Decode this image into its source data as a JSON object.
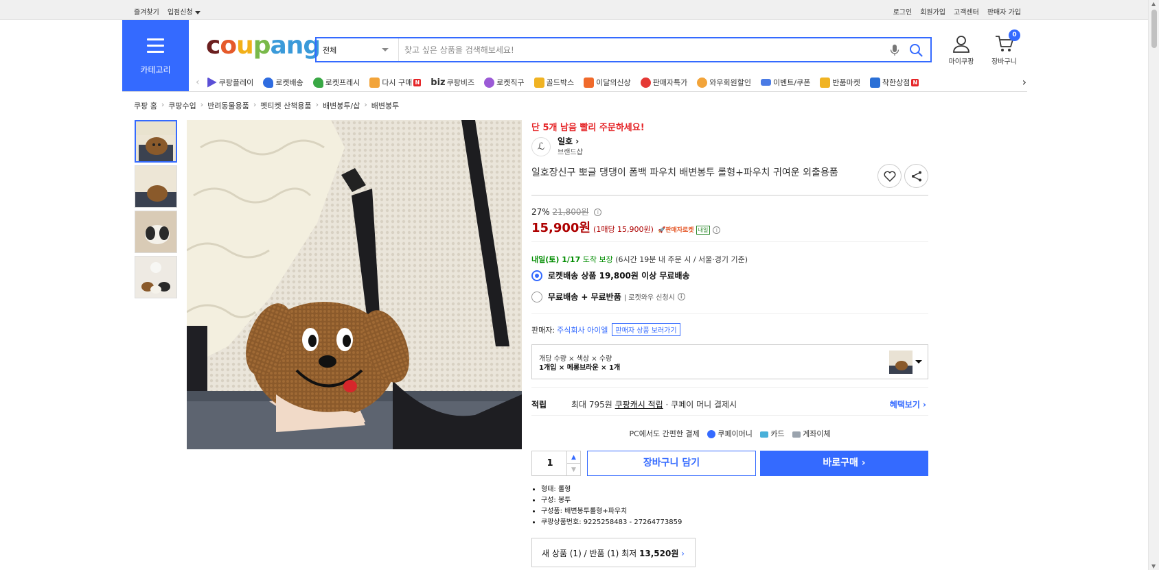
{
  "topbar": {
    "left": [
      "즐겨찾기",
      "입점신청"
    ],
    "right": [
      "로그인",
      "회원가입",
      "고객센터",
      "판매자 가입"
    ]
  },
  "category_button": {
    "label": "카테고리"
  },
  "logo": {
    "text_parts": [
      "c",
      "o",
      "u",
      "p",
      "ang"
    ]
  },
  "search": {
    "scope": "전체",
    "placeholder": "찾고 싶은 상품을 검색해보세요!"
  },
  "header_icons": {
    "mycoupang": "마이쿠팡",
    "cart": "장바구니",
    "cart_count": "0"
  },
  "nav": {
    "items": [
      {
        "label": "쿠팡플레이",
        "icon": "play-icon",
        "color": "#5a4fd6"
      },
      {
        "label": "로켓배송",
        "icon": "rocket-icon",
        "color": "#2f6ce0"
      },
      {
        "label": "로켓프레시",
        "icon": "rocket-fresh-icon",
        "color": "#39a845"
      },
      {
        "label": "다시 구매",
        "icon": "bag-icon",
        "color": "#f2a43a"
      },
      {
        "label": "쿠팡비즈",
        "icon": "biz-icon",
        "color": "#222222",
        "prefix": "biz"
      },
      {
        "label": "로켓직구",
        "icon": "globe-icon",
        "color": "#9b5ad6"
      },
      {
        "label": "골드박스",
        "icon": "goldbox-icon",
        "color": "#f0b323"
      },
      {
        "label": "이달의신상",
        "icon": "shopping-bag-icon",
        "color": "#f06a2b"
      },
      {
        "label": "판매자특가",
        "icon": "percent-icon",
        "color": "#e53935"
      },
      {
        "label": "와우회원할인",
        "icon": "wow-icon",
        "color": "#f2a43a"
      },
      {
        "label": "이벤트/쿠폰",
        "icon": "coupon-icon",
        "color": "#4a7be5"
      },
      {
        "label": "반품마켓",
        "icon": "market-icon",
        "color": "#f0b323"
      },
      {
        "label": "착한상점",
        "icon": "store-icon",
        "color": "#2a6fd6"
      }
    ],
    "new_badge": "N"
  },
  "breadcrumb": [
    "쿠팡 홈",
    "쿠팡수입",
    "반려동물용품",
    "펫티켓 산책용품",
    "배변봉투/삽",
    "배변봉투"
  ],
  "product": {
    "urgent": "단 5개 남음 빨리 주문하세요!",
    "brand_name": "일호",
    "brand_sub": "브랜드샵",
    "title": "일호장신구 뽀글 댕댕이 폼백 파우치 배변봉투 롤형+파우치 귀여운 외출용품",
    "discount_rate": "27%",
    "original_price": "21,800원",
    "price": "15,900원",
    "unit_price": "(1매당 15,900원)",
    "rocket_label": "판매자로켓",
    "tomorrow_tag": "내일",
    "delivery_date": "내일(토) 1/17",
    "delivery_guarantee": "도착 보장",
    "delivery_note": "(6시간 19분 내 주문 시 / 서울·경기 기준)",
    "option1": "로켓배송 상품 19,800원 이상 무료배송",
    "option2": "무료배송 + 무료반품",
    "option2_note": "로켓와우 신청시",
    "seller_label": "판매자:",
    "seller_name": "주식회사 아이엘",
    "seller_link": "판매자 상품 보러가기",
    "option_line1": "개당 수량 × 색상 × 수량",
    "option_line2": "1개입 × 메롱브라운 × 1개",
    "reward_label": "적립",
    "reward_text_a": "최대 795원 ",
    "reward_text_b": "쿠팡캐시 적립",
    "reward_text_c": " · 쿠페이 머니 결제시",
    "reward_link": "혜택보기 ›",
    "pc_pay": "PC에서도 간편한 결제",
    "pay_methods": [
      "쿠페이머니",
      "카드",
      "계좌이체"
    ],
    "quantity": "1",
    "add_cart": "장바구니 담기",
    "buy_now": "바로구매 ›",
    "specs": [
      "형태: 롤형",
      "구성: 봉투",
      "구성품: 배변봉투롤형+파우치",
      "쿠팡상품번호: 9225258483 - 27264773859"
    ],
    "offer_a": "새 상품 (1) / 반품 (1) 최저 ",
    "offer_b": "13,520원",
    "offer_c": " ›"
  },
  "colors": {
    "accent": "#346aff",
    "price": "#ae0000",
    "urgent": "#e52528",
    "delivery": "#008c00"
  }
}
